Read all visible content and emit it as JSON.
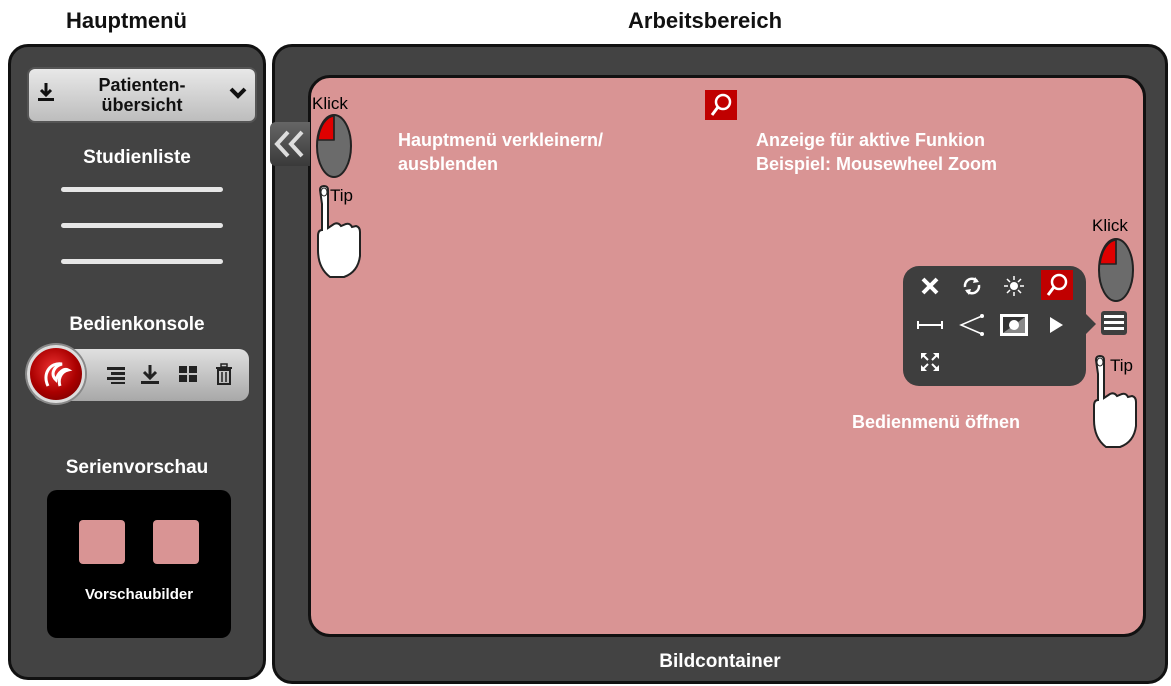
{
  "headers": {
    "left": "Hauptmenü",
    "right": "Arbeitsbereich"
  },
  "sidebar": {
    "patient_dropdown": {
      "line1": "Patienten-",
      "line2": "übersicht"
    },
    "study_list_title": "Studienliste",
    "console_title": "Bedienkonsole",
    "series_title": "Serienvorschau",
    "preview_label": "Vorschaubilder"
  },
  "workspace": {
    "container_label": "Bildcontainer",
    "annotation_collapse": {
      "line1": "Hauptmenü verkleinern/",
      "line2": "ausblenden"
    },
    "annotation_active": {
      "line1": "Anzeige für aktive Funkion",
      "line2": "Beispiel: Mousewheel Zoom"
    },
    "annotation_menu": "Bedienmenü öffnen",
    "mouse_label_left": "Klick",
    "tip_label_left": "Tip",
    "mouse_label_right": "Klick",
    "tip_label_right": "Tip"
  },
  "colors": {
    "container": "#d99494",
    "panel": "#434343",
    "active": "#c00000"
  },
  "icons": {
    "console": [
      "list-icon",
      "download-icon",
      "grid-icon",
      "trash-icon"
    ],
    "tool_menu": [
      "close-icon",
      "rotate-icon",
      "brightness-icon",
      "zoom-icon",
      "ruler-icon",
      "angle-icon",
      "invert-icon",
      "play-icon",
      "fullscreen-icon"
    ]
  }
}
